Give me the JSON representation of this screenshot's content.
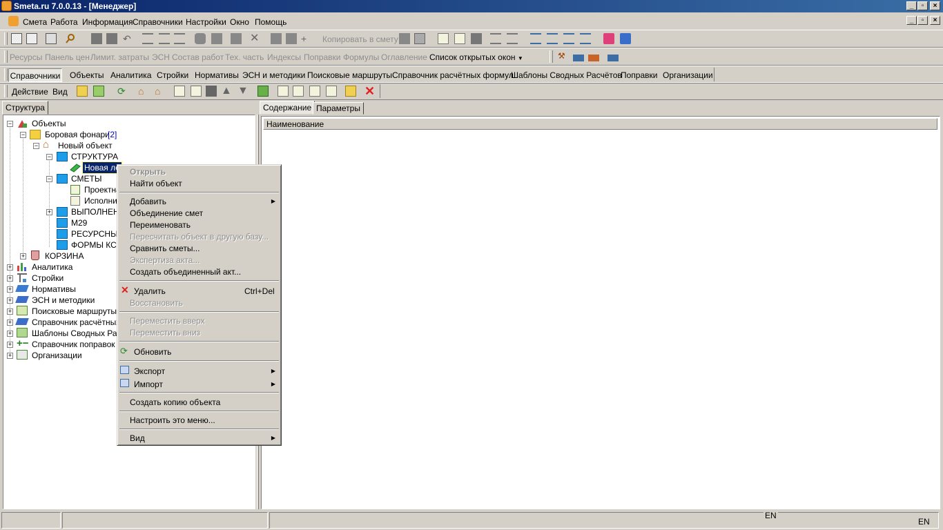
{
  "window": {
    "title": "Smeta.ru  7.0.0.13  - [Менеджер]"
  },
  "menu": [
    "Смета",
    "Работа",
    "Информация",
    "Справочники",
    "Настройки",
    "Окно",
    "Помощь"
  ],
  "toolbar1": {
    "copy_to_estimate": "Копировать в смету"
  },
  "toolbar2": {
    "items": [
      "Ресурсы",
      "Панель цен",
      "Лимит. затраты",
      "ЭСН",
      "Состав работ",
      "Тех. часть",
      "Индексы",
      "Поправки",
      "Формулы",
      "Оглавление"
    ],
    "open_windows": "Список открытых окон"
  },
  "navtabs": [
    "Справочники",
    "Объекты",
    "Аналитика",
    "Стройки",
    "Нормативы",
    "ЭСН и методики",
    "Поисковые маршруты",
    "Справочник расчётных формул",
    "Шаблоны Сводных Расчётов",
    "Поправки",
    "Организации"
  ],
  "actionbar": {
    "action": "Действие",
    "view": "Вид"
  },
  "left_panel": {
    "tab": "Структура"
  },
  "tree": {
    "root": "Объекты",
    "borovaya": "Боровая фонари",
    "borovaya_count": "[2]",
    "new_object": "Новый объект",
    "structure": "СТРУКТУРА",
    "new_lo": "Новая ло",
    "smety": "СМЕТЫ",
    "proektn": "Проектна",
    "ispoln": "Исполни",
    "vypolnen": "ВЫПОЛНЕН",
    "m29": "М29",
    "resursn": "РЕСУРСНЫЕ",
    "formy": "ФОРМЫ КС-",
    "korzina": "КОРЗИНА",
    "analitika": "Аналитика",
    "stroyki": "Стройки",
    "normativy": "Нормативы",
    "esn": "ЭСН и методики",
    "poisk": "Поисковые маршруты",
    "sprav_formul": "Справочник расчётных ф",
    "shablony": "Шаблоны Сводных Расче",
    "sprav_popravok": "Справочник поправок",
    "organizacii": "Организации"
  },
  "right_panel": {
    "tab_content": "Содержание",
    "tab_params": "Параметры",
    "col_name": "Наименование"
  },
  "context_menu": {
    "open": "Открыть",
    "find": "Найти объект",
    "add": "Добавить",
    "merge": "Объединение смет",
    "rename": "Переименовать",
    "recalc": "Пересчитать объект в другую базу...",
    "compare": "Сравнить сметы...",
    "expertise": "Экспертиза акта...",
    "create_merged": "Создать объединенный акт...",
    "delete": "Удалить",
    "delete_shortcut": "Ctrl+Del",
    "restore": "Восстановить",
    "move_up": "Переместить вверх",
    "move_down": "Переместить вниз",
    "refresh": "Обновить",
    "export": "Экспорт",
    "import": "Импорт",
    "copy": "Создать копию объекта",
    "configure": "Настроить это меню...",
    "view": "Вид"
  },
  "status": {
    "lang1": "EN",
    "lang2": "EN"
  },
  "colors": {
    "titlebar": "#0a246a",
    "face": "#d4d0c8",
    "folder": "#1e9ee8",
    "delete_red": "#e02020"
  }
}
